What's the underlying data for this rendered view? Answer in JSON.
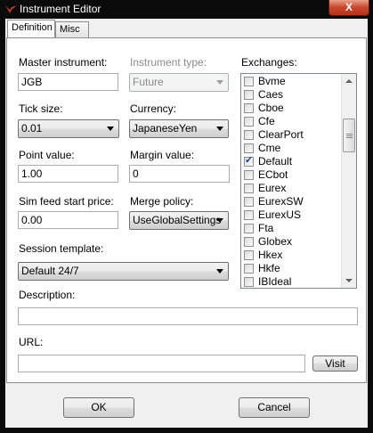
{
  "window": {
    "title": "Instrument Editor",
    "close_label": "X"
  },
  "tabs": [
    {
      "label": "Definition"
    },
    {
      "label": "Misc"
    }
  ],
  "form": {
    "master_instrument": {
      "label": "Master instrument:",
      "value": "JGB"
    },
    "instrument_type": {
      "label": "Instrument type:",
      "value": "Future"
    },
    "tick_size": {
      "label": "Tick size:",
      "value": "0.01"
    },
    "currency": {
      "label": "Currency:",
      "value": "JapaneseYen"
    },
    "point_value": {
      "label": "Point value:",
      "value": "1.00"
    },
    "margin_value": {
      "label": "Margin value:",
      "value": "0"
    },
    "sim_feed_start_price": {
      "label": "Sim feed start price:",
      "value": "0.00"
    },
    "merge_policy": {
      "label": "Merge policy:",
      "value": "UseGlobalSettings"
    },
    "session_template": {
      "label": "Session template:",
      "value": "Default 24/7"
    },
    "description": {
      "label": "Description:",
      "value": ""
    },
    "url": {
      "label": "URL:",
      "value": ""
    }
  },
  "exchanges": {
    "label": "Exchanges:",
    "items": [
      {
        "name": "Bvme",
        "checked": false
      },
      {
        "name": "Caes",
        "checked": false
      },
      {
        "name": "Cboe",
        "checked": false
      },
      {
        "name": "Cfe",
        "checked": false
      },
      {
        "name": "ClearPort",
        "checked": false
      },
      {
        "name": "Cme",
        "checked": false
      },
      {
        "name": "Default",
        "checked": true
      },
      {
        "name": "ECbot",
        "checked": false
      },
      {
        "name": "Eurex",
        "checked": false
      },
      {
        "name": "EurexSW",
        "checked": false
      },
      {
        "name": "EurexUS",
        "checked": false
      },
      {
        "name": "Fta",
        "checked": false
      },
      {
        "name": "Globex",
        "checked": false
      },
      {
        "name": "Hkex",
        "checked": false
      },
      {
        "name": "Hkfe",
        "checked": false
      },
      {
        "name": "IBIdeal",
        "checked": false
      }
    ]
  },
  "buttons": {
    "visit": "Visit",
    "ok": "OK",
    "cancel": "Cancel"
  },
  "colors": {
    "titlebar": "#0b0b0b",
    "close_button": "#c9452b",
    "logo": "#c0392b",
    "dialog_bg": "#f0f0f0"
  }
}
